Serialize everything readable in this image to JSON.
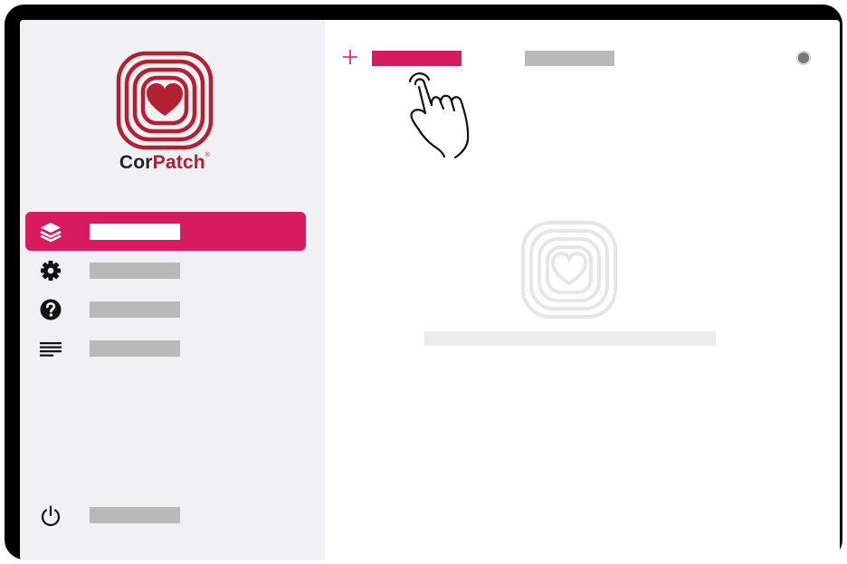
{
  "app": {
    "brand_cor": "Cor",
    "brand_patch": "Patch",
    "brand_mark": "®"
  },
  "sidebar": {
    "items": [
      {
        "icon": "layers-icon",
        "label": "",
        "active": true
      },
      {
        "icon": "gear-icon",
        "label": ""
      },
      {
        "icon": "help-icon",
        "label": ""
      },
      {
        "icon": "list-icon",
        "label": ""
      }
    ],
    "power": {
      "icon": "power-icon",
      "label": ""
    }
  },
  "main": {
    "add_icon": "plus-icon",
    "tabs": [
      {
        "label": "",
        "active": true
      },
      {
        "label": ""
      }
    ],
    "empty_state": {
      "icon": "corpatch-heart-logo-faded",
      "text": ""
    },
    "gesture": "tap-hand-icon"
  },
  "colors": {
    "accent": "#d81b5e",
    "brand": "#b3202f",
    "sidebar_bg": "#f0f0f5",
    "placeholder": "#b9b9b9"
  }
}
